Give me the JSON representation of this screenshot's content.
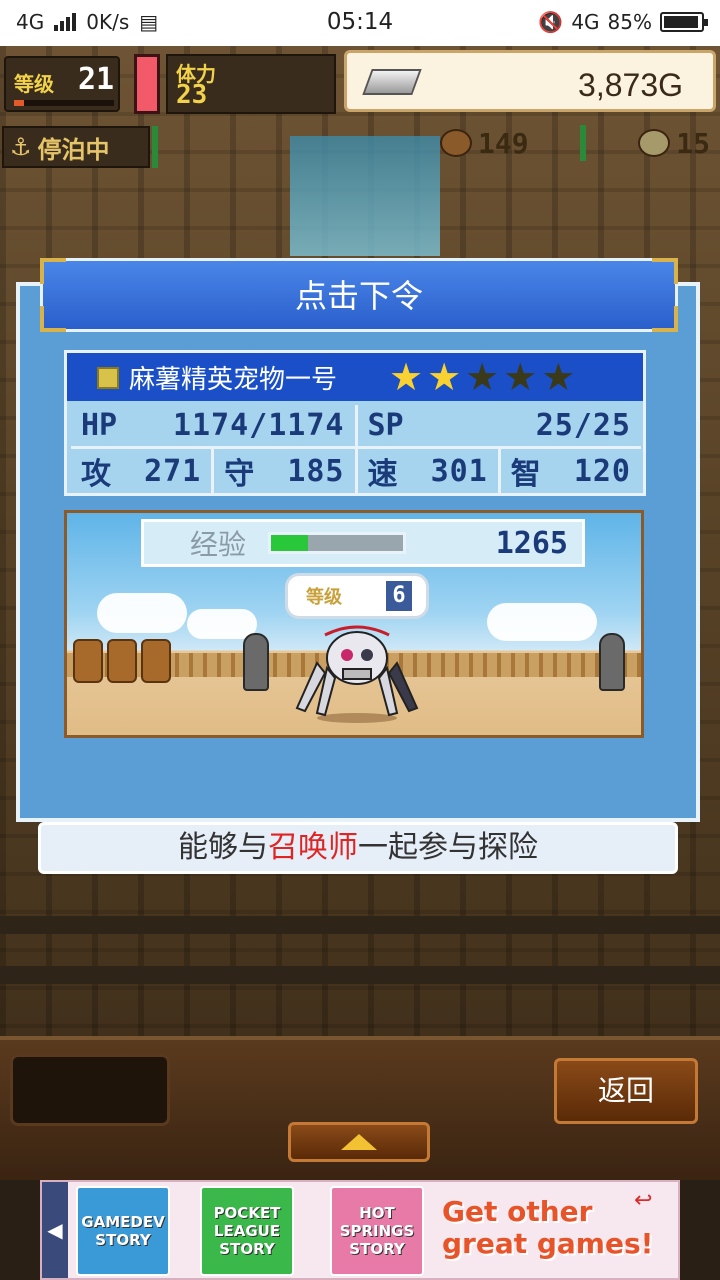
{
  "status_bar": {
    "network": "4G",
    "speed": "0K/s",
    "time": "05:14",
    "network_right": "4G",
    "battery": "85%"
  },
  "hud": {
    "level_label": "等级",
    "level_value": "21",
    "stamina_label": "体力",
    "stamina_value": "23",
    "gold": "3,873G",
    "dock_status": "停泊中",
    "resource_1": "149",
    "resource_2": "15"
  },
  "dialog": {
    "title": "点击下令",
    "pet": {
      "name": "麻薯精英宠物一号",
      "stars_filled": 2,
      "stars_total": 5,
      "hp_label": "HP",
      "hp_value": "1174/1174",
      "sp_label": "SP",
      "sp_value": "25/25",
      "atk_label": "攻",
      "atk_value": "271",
      "def_label": "守",
      "def_value": "185",
      "spd_label": "速",
      "spd_value": "301",
      "int_label": "智",
      "int_value": "120"
    },
    "preview": {
      "exp_label": "经验",
      "exp_value": "1265",
      "exp_progress": 0.28,
      "level_label": "等级",
      "level_value": "6"
    },
    "caption_before": "能够与",
    "caption_highlight": "召唤师",
    "caption_after": "一起参与探险"
  },
  "bottom": {
    "back_label": "返回"
  },
  "ad": {
    "games": [
      {
        "name": "GAMEDEV STORY",
        "color": "#3a9ad8"
      },
      {
        "name": "POCKET LEAGUE STORY",
        "color": "#3ab84a"
      },
      {
        "name": "HOT SPRINGS STORY",
        "color": "#e87aa8"
      }
    ],
    "cta": "Get other great games!"
  },
  "colors": {
    "dialog_blue": "#5b9ed6",
    "title_blue": "#2a5fcc",
    "highlight_red": "#e02424",
    "exp_green": "#28c83a",
    "star_gold": "#f7d232"
  }
}
